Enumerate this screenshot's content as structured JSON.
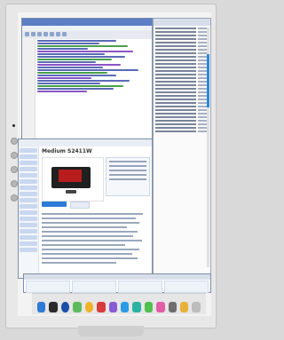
{
  "window_title": "",
  "ide": {
    "title": "",
    "menu": ""
  },
  "right_panel": {
    "title": ""
  },
  "browser": {
    "top_bar": "",
    "product_title": "Medium S2411W"
  },
  "bottom_window": {
    "title": ""
  },
  "dock": {
    "icons": [
      "finder-icon",
      "launchpad-icon",
      "safari-icon",
      "leaf-icon",
      "sun-icon",
      "red-app-icon",
      "purple-app-icon",
      "blue-app-icon",
      "teal-app-icon",
      "green-app-icon",
      "pink-app-icon",
      "tool-icon",
      "pencil-icon",
      "trash-icon"
    ]
  }
}
